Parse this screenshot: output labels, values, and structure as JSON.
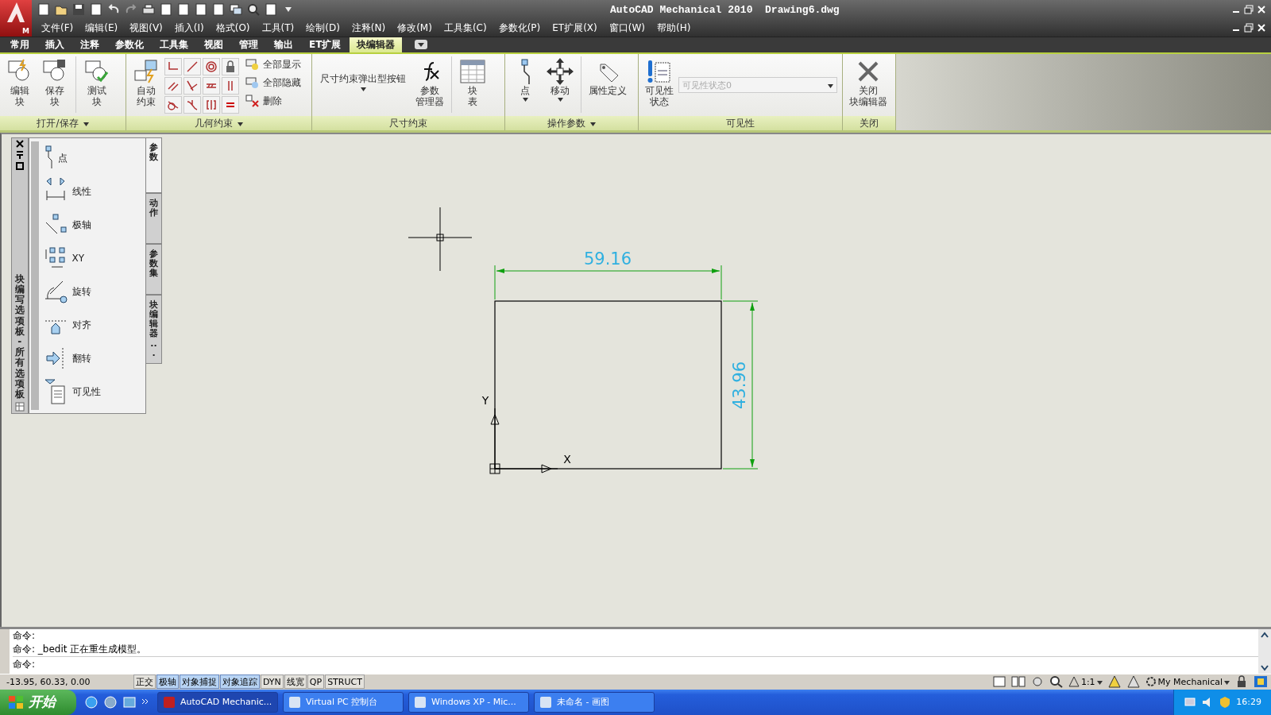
{
  "title_bar": {
    "logo_badge": "M",
    "app_title": "AutoCAD Mechanical 2010",
    "document": "Drawing6.dwg"
  },
  "menu": [
    "文件(F)",
    "编辑(E)",
    "视图(V)",
    "插入(I)",
    "格式(O)",
    "工具(T)",
    "绘制(D)",
    "注释(N)",
    "修改(M)",
    "工具集(C)",
    "参数化(P)",
    "ET扩展(X)",
    "窗口(W)",
    "帮助(H)"
  ],
  "ribbon_tabs": [
    {
      "label": "常用",
      "selected": false
    },
    {
      "label": "插入",
      "selected": false
    },
    {
      "label": "注释",
      "selected": false
    },
    {
      "label": "参数化",
      "selected": false
    },
    {
      "label": "工具集",
      "selected": false
    },
    {
      "label": "视图",
      "selected": false
    },
    {
      "label": "管理",
      "selected": false
    },
    {
      "label": "输出",
      "selected": false
    },
    {
      "label": "ET扩展",
      "selected": false
    },
    {
      "label": "块编辑器",
      "selected": true
    }
  ],
  "ribbon_panels": [
    {
      "title": "打开/保存",
      "has_menu": true,
      "items": [
        {
          "kind": "large",
          "lines": [
            "编辑",
            "块"
          ]
        },
        {
          "kind": "large",
          "lines": [
            "保存",
            "块"
          ]
        },
        {
          "kind": "separator"
        },
        {
          "kind": "large",
          "lines": [
            "测试",
            "块"
          ]
        }
      ]
    },
    {
      "title": "几何约束",
      "has_menu": true,
      "items": [
        {
          "kind": "large",
          "lines": [
            "自动",
            "约束"
          ]
        },
        {
          "kind": "grid"
        },
        {
          "kind": "small_list",
          "entries": [
            "全部显示",
            "全部隐藏",
            "删除"
          ]
        }
      ]
    },
    {
      "title": "尺寸约束",
      "has_menu": false,
      "items": [
        {
          "kind": "split",
          "label": "尺寸约束弹出型按钮"
        },
        {
          "kind": "large",
          "lines": [
            "参数",
            "管理器"
          ]
        },
        {
          "kind": "separator"
        },
        {
          "kind": "large",
          "lines": [
            "块",
            "表"
          ]
        }
      ]
    },
    {
      "title": "操作参数",
      "has_menu": true,
      "items": [
        {
          "kind": "large",
          "lines": [
            "点"
          ],
          "caret": true
        },
        {
          "kind": "large",
          "lines": [
            "移动"
          ],
          "caret": true
        },
        {
          "kind": "separator"
        },
        {
          "kind": "large",
          "lines": [
            "属性定义"
          ]
        }
      ]
    },
    {
      "title": "可见性",
      "has_menu": false,
      "items": [
        {
          "kind": "large",
          "lines": [
            "可见性",
            "状态"
          ]
        },
        {
          "kind": "combo",
          "value": "可见性状态0",
          "disabled": true
        }
      ]
    },
    {
      "title": "关闭",
      "has_menu": false,
      "items": [
        {
          "kind": "large",
          "lines": [
            "关闭",
            "块编辑器"
          ]
        }
      ]
    }
  ],
  "palette": {
    "title": "块编写选项板 - 所有选项板",
    "items": [
      "点",
      "线性",
      "极轴",
      "XY",
      "旋转",
      "对齐",
      "翻转",
      "可见性"
    ],
    "tabs": [
      {
        "label": "参数",
        "selected": true
      },
      {
        "label": "动作",
        "selected": false
      },
      {
        "label": "参数集",
        "selected": false
      },
      {
        "label": "块编辑器...",
        "selected": false
      }
    ]
  },
  "drawing": {
    "width_dimension": "59.16",
    "height_dimension": "43.96",
    "ucs_y": "Y",
    "ucs_x": "X"
  },
  "command": {
    "history": [
      "命令:",
      "命令: _bedit 正在重生成模型。"
    ],
    "prompt": "命令:"
  },
  "status_bar": {
    "coordinates": "-13.95, 60.33, 0.00",
    "toggles": [
      {
        "label": "正交",
        "on": false
      },
      {
        "label": "极轴",
        "on": true
      },
      {
        "label": "对象捕捉",
        "on": true
      },
      {
        "label": "对象追踪",
        "on": true
      },
      {
        "label": "DYN",
        "on": false
      },
      {
        "label": "线宽",
        "on": false
      },
      {
        "label": "QP",
        "on": false
      },
      {
        "label": "STRUCT",
        "on": false
      }
    ],
    "scale": "1:1",
    "workspace": "My Mechanical"
  },
  "taskbar": {
    "start": "开始",
    "tasks": [
      {
        "label": "AutoCAD Mechanic...",
        "selected": true
      },
      {
        "label": "Virtual PC 控制台",
        "selected": false
      },
      {
        "label": "Windows XP - Mic...",
        "selected": false
      },
      {
        "label": "未命名 - 画图",
        "selected": false
      }
    ],
    "clock": "16:29"
  }
}
